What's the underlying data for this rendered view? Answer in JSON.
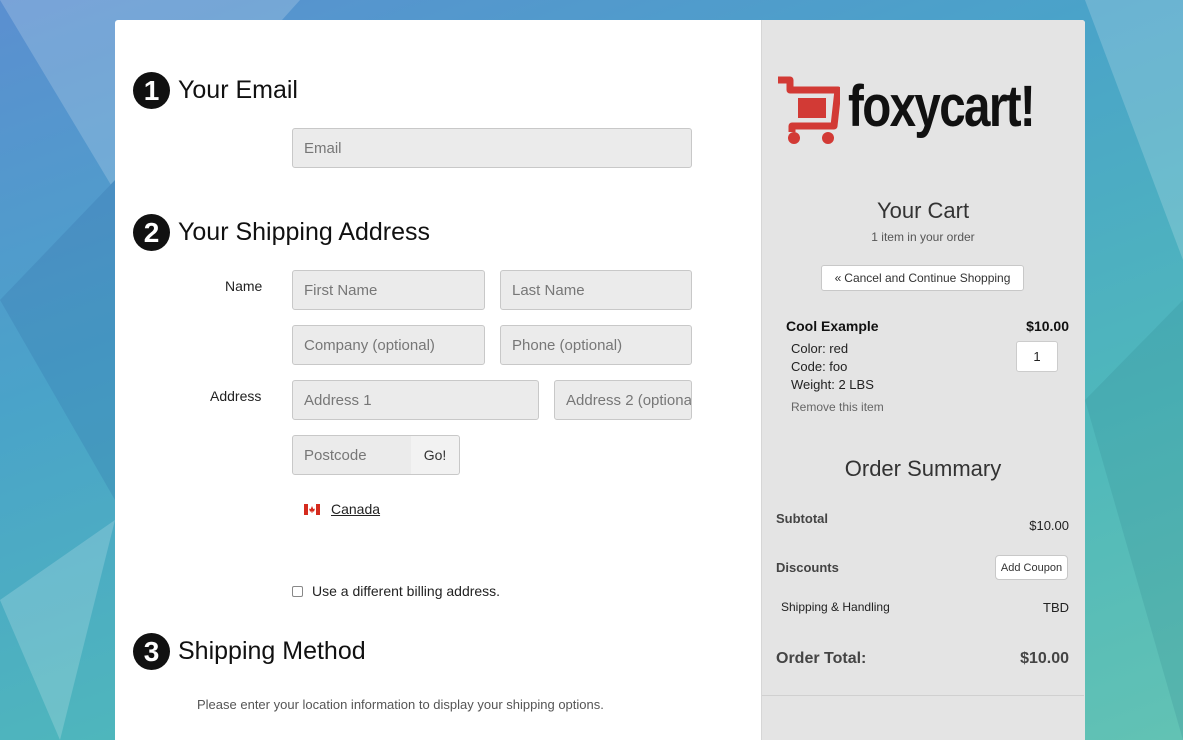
{
  "colors": {
    "accent": "#d23a35",
    "panel": "#e4e4e4",
    "text": "#111111"
  },
  "sections": {
    "email": {
      "number": "1",
      "title": "Your Email",
      "placeholder": "Email"
    },
    "shipping": {
      "number": "2",
      "title": "Your Shipping Address",
      "name_label": "Name",
      "address_label": "Address",
      "first_name": "First Name",
      "last_name": "Last Name",
      "company": "Company (optional)",
      "phone": "Phone (optional)",
      "address1": "Address 1",
      "address2": "Address 2 (optiona",
      "postcode": "Postcode",
      "go_label": "Go!",
      "country": "Canada",
      "country_icon": "canada-flag-icon",
      "billing_label": "Use a different billing address."
    },
    "method": {
      "number": "3",
      "title": "Shipping Method",
      "message": "Please enter your location information to display your shipping options."
    }
  },
  "sidebar": {
    "logo_text": "foxycart!",
    "logo_icon": "shopping-cart-icon",
    "cart_title": "Your Cart",
    "cart_count": "1 item in your order",
    "cancel_label": "Cancel and Continue Shopping",
    "item": {
      "name": "Cool Example",
      "price": "$10.00",
      "options": [
        "Color: red",
        "Code: foo",
        "Weight: 2 LBS"
      ],
      "quantity": "1",
      "remove_label": "Remove this item"
    },
    "summary": {
      "title": "Order Summary",
      "subtotal_label": "Subtotal",
      "subtotal_value": "$10.00",
      "discounts_label": "Discounts",
      "coupon_label": "Add Coupon",
      "shipping_label": "Shipping & Handling",
      "shipping_value": "TBD",
      "total_label": "Order Total:",
      "total_value": "$10.00"
    }
  }
}
